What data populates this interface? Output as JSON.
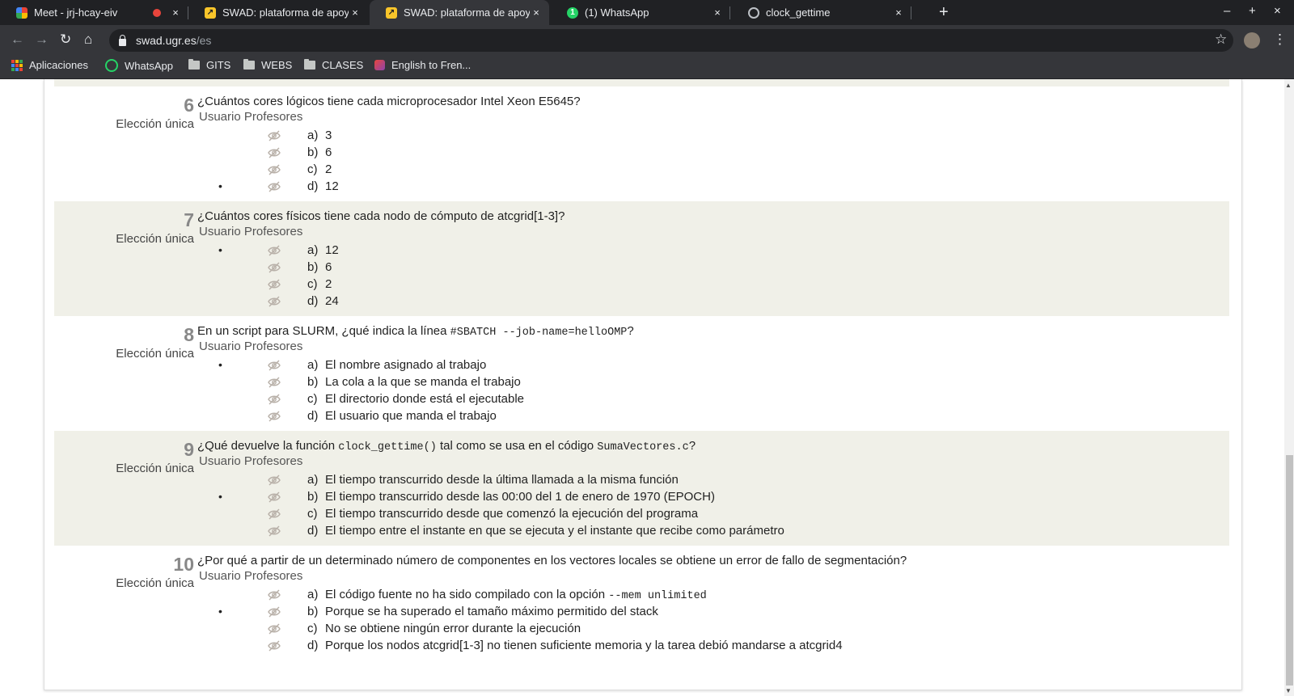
{
  "browser": {
    "tabs": [
      {
        "title": "Meet - jrj-hcay-eiv",
        "favicon": "meet-icon",
        "recording": true
      },
      {
        "title": "SWAD: plataforma de apoyo",
        "favicon": "swad-icon"
      },
      {
        "title": "SWAD: plataforma de apoyo",
        "favicon": "swad-icon",
        "active": true
      },
      {
        "title": "(1) WhatsApp",
        "favicon": "whatsapp-icon"
      },
      {
        "title": "clock_gettime",
        "favicon": "globe-icon"
      }
    ],
    "close_glyph": "×",
    "new_tab_glyph": "+",
    "window_controls": {
      "minimize": "–",
      "maximize": "+",
      "close": "×"
    },
    "url_host": "swad.ugr.es",
    "url_path": "/es",
    "bookmarks": [
      {
        "label": "Aplicaciones",
        "icon": "apps-icon"
      },
      {
        "label": "WhatsApp",
        "icon": "whatsapp-icon"
      },
      {
        "label": "GITS",
        "icon": "folder-icon"
      },
      {
        "label": "WEBS",
        "icon": "folder-icon"
      },
      {
        "label": "CLASES",
        "icon": "folder-icon"
      },
      {
        "label": "English to Fren...",
        "icon": "reverso-icon"
      }
    ]
  },
  "colors": {
    "row_shade": "#f0f0e8",
    "question_number": "#888888",
    "eye_icon": "#b8b0a8"
  },
  "questions": [
    {
      "number": "6",
      "type": "Elección única",
      "text": "¿Cuántos cores lógicos tiene cada microprocesador Intel Xeon E5645?",
      "tags": "Usuario Profesores",
      "shaded": false,
      "answers": [
        {
          "letter": "a)",
          "text": "3",
          "bullet": ""
        },
        {
          "letter": "b)",
          "text": "6",
          "bullet": ""
        },
        {
          "letter": "c)",
          "text": "2",
          "bullet": ""
        },
        {
          "letter": "d)",
          "text": "12",
          "bullet": "•"
        }
      ]
    },
    {
      "number": "7",
      "type": "Elección única",
      "text": "¿Cuántos cores físicos tiene cada nodo de cómputo de atcgrid[1-3]?",
      "tags": "Usuario Profesores",
      "shaded": true,
      "answers": [
        {
          "letter": "a)",
          "text": "12",
          "bullet": "•"
        },
        {
          "letter": "b)",
          "text": "6",
          "bullet": ""
        },
        {
          "letter": "c)",
          "text": "2",
          "bullet": ""
        },
        {
          "letter": "d)",
          "text": "24",
          "bullet": ""
        }
      ]
    },
    {
      "number": "8",
      "type": "Elección única",
      "text_pre": "En un script para SLURM, ¿qué indica la línea ",
      "text_code": "#SBATCH --job-name=helloOMP",
      "text_post": "?",
      "tags": "Usuario Profesores",
      "shaded": false,
      "answers": [
        {
          "letter": "a)",
          "text": "El nombre asignado al trabajo",
          "bullet": "•"
        },
        {
          "letter": "b)",
          "text": "La cola a la que se manda el trabajo",
          "bullet": ""
        },
        {
          "letter": "c)",
          "text": "El directorio donde está el ejecutable",
          "bullet": ""
        },
        {
          "letter": "d)",
          "text": "El usuario que manda el trabajo",
          "bullet": ""
        }
      ]
    },
    {
      "number": "9",
      "type": "Elección única",
      "text_pre": "¿Qué devuelve la función ",
      "text_code": "clock_gettime()",
      "text_mid": " tal como se usa en el código ",
      "text_code2": "SumaVectores.c",
      "text_post": "?",
      "tags": "Usuario Profesores",
      "shaded": true,
      "answers": [
        {
          "letter": "a)",
          "text": "El tiempo transcurrido desde la última llamada a la misma función",
          "bullet": ""
        },
        {
          "letter": "b)",
          "text": "El tiempo transcurrido desde las 00:00 del 1 de enero de 1970 (EPOCH)",
          "bullet": "•"
        },
        {
          "letter": "c)",
          "text": "El tiempo transcurrido desde que comenzó la ejecución del programa",
          "bullet": ""
        },
        {
          "letter": "d)",
          "text": "El tiempo entre el instante en que se ejecuta y el instante que recibe como parámetro",
          "bullet": ""
        }
      ]
    },
    {
      "number": "10",
      "type": "Elección única",
      "text": "¿Por qué a partir de un determinado número de componentes en los vectores locales se obtiene un error de fallo de segmentación?",
      "tags": "Usuario Profesores",
      "shaded": false,
      "answers": [
        {
          "letter": "a)",
          "text_pre": "El código fuente no ha sido compilado con la opción ",
          "text_code": "--mem unlimited",
          "bullet": ""
        },
        {
          "letter": "b)",
          "text": "Porque se ha superado el tamaño máximo permitido del stack",
          "bullet": "•"
        },
        {
          "letter": "c)",
          "text": "No se obtiene ningún error durante la ejecución",
          "bullet": ""
        },
        {
          "letter": "d)",
          "text": "Porque los nodos atcgrid[1-3] no tienen suficiente memoria y la tarea debió mandarse a atcgrid4",
          "bullet": ""
        }
      ]
    }
  ]
}
